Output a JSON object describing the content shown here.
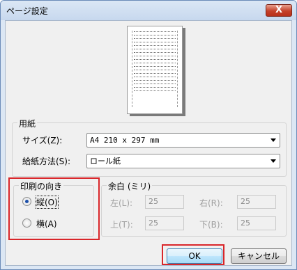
{
  "window": {
    "title": "ページ設定",
    "close_label": "X"
  },
  "paper": {
    "group_label": "用紙",
    "size_label": "サイズ(Z):",
    "size_value": "A4 210 x 297 mm",
    "source_label": "給紙方法(S):",
    "source_value": "ロール紙"
  },
  "orientation": {
    "group_label": "印刷の向き",
    "portrait_label": "縦(O)",
    "landscape_label": "横(A)",
    "selected": "portrait"
  },
  "margins": {
    "group_label": "余白 (ミリ)",
    "left_label": "左(L):",
    "left_value": "25",
    "right_label": "右(R):",
    "right_value": "25",
    "top_label": "上(T):",
    "top_value": "25",
    "bottom_label": "下(B):",
    "bottom_value": "25"
  },
  "buttons": {
    "ok_label": "OK",
    "cancel_label": "キャンセル"
  },
  "colors": {
    "highlight": "#d9262a",
    "accent": "#1c4fa8"
  }
}
